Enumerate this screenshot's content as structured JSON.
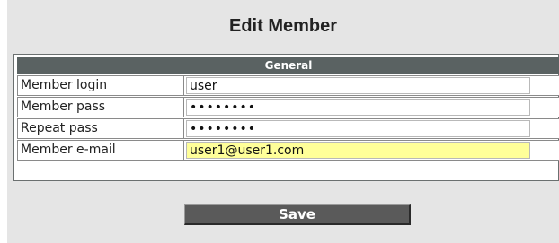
{
  "page": {
    "title": "Edit Member"
  },
  "form": {
    "section_label": "General",
    "fields": [
      {
        "label": "Member login",
        "value": "user",
        "type": "text"
      },
      {
        "label": "Member pass",
        "value": "abcdefgh",
        "type": "password"
      },
      {
        "label": "Repeat pass",
        "value": "abcdefgh",
        "type": "password"
      },
      {
        "label": "Member e-mail",
        "value": "user1@user1.com",
        "type": "text",
        "highlighted": true
      }
    ]
  },
  "actions": {
    "save_label": "Save"
  },
  "colors": {
    "panel_background": "#e5e5e5",
    "section_header": "#5a6262",
    "input_highlight": "#ffff99",
    "button_background": "#5a5a5a"
  }
}
